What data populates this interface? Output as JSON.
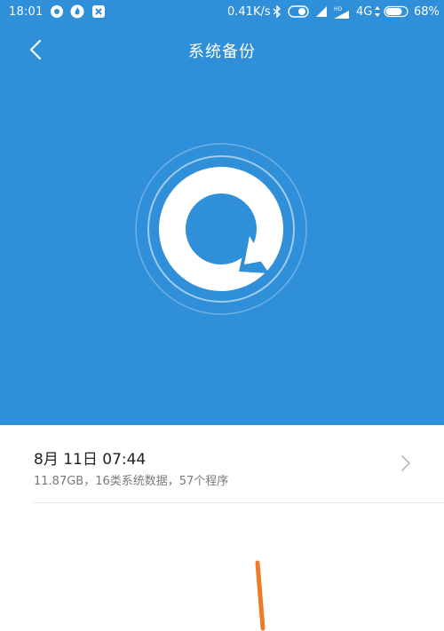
{
  "status_bar": {
    "time": "18:01",
    "net_speed": "0.41K/s",
    "network": "4G",
    "signal_badge": "HD",
    "battery": "68%",
    "icons": [
      "chat-bubble-icon",
      "flame-app-icon",
      "puzzle-app-icon",
      "bluetooth-icon",
      "toggle-icon",
      "signal-icon",
      "data-arrows-icon",
      "battery-icon"
    ]
  },
  "header": {
    "title": "系统备份",
    "back_icon": "chevron-left-icon"
  },
  "backup": {
    "date": "8月 11日 07:44",
    "summary": "11.87GB，16类系统数据，57个程序",
    "chevron_icon": "chevron-right-icon"
  },
  "colors": {
    "primary": "#2f8fd9",
    "accent": "#f07a2a",
    "card_bg": "#ffffff",
    "secondary_text": "#7a7a7a"
  }
}
